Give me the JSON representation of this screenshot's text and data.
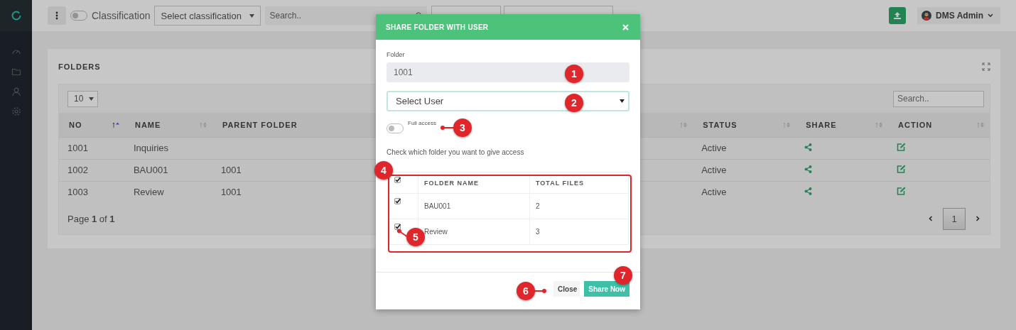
{
  "toolbar": {
    "classification_toggle": {
      "label": "Classification",
      "on": false
    },
    "classification_select": {
      "placeholder": "Select classification"
    },
    "search": {
      "placeholder": "Search.."
    },
    "user_menu": {
      "name": "DMS Admin"
    }
  },
  "panel": {
    "title": "FOLDERS",
    "page_length": "10",
    "search": {
      "placeholder": "Search.."
    },
    "table": {
      "columns": [
        {
          "label": "NO",
          "sorted": true
        },
        {
          "label": "NAME",
          "sorted": false
        },
        {
          "label": "PARENT FOLDER",
          "sorted": false
        },
        {
          "label": "STATUS",
          "sorted": false
        },
        {
          "label": "SHARE",
          "sorted": false
        },
        {
          "label": "ACTION",
          "sorted": false
        }
      ],
      "rows": [
        {
          "no": "1001",
          "name": "Inquiries",
          "status": "Active"
        },
        {
          "no": "1002",
          "name": "BAU001",
          "parent": "1001",
          "status": "Active"
        },
        {
          "no": "1003",
          "name": "Review",
          "parent": "1001",
          "status": "Active"
        }
      ]
    },
    "pagination": {
      "info": "Page **1** of **1**",
      "pages": [
        {
          "label": "1",
          "selected": true
        }
      ]
    }
  },
  "dialog": {
    "title": "SHARE FOLDER WITH USER",
    "folder_label": "Folder",
    "folder_value": "1001",
    "user_select": {
      "placeholder": "Select User"
    },
    "full_access": {
      "label": "Full access",
      "on": false
    },
    "instruction": "Check which folder you want to give access",
    "table": {
      "header_checked": true,
      "columns": [
        "FOLDER NAME",
        "TOTAL FILES"
      ],
      "rows": [
        {
          "name": "BAU001",
          "files": "2",
          "checked": true
        },
        {
          "name": "Review",
          "files": "3",
          "checked": true
        }
      ]
    },
    "buttons": [
      {
        "kind": "close",
        "label": "Close"
      },
      {
        "kind": "primary",
        "label": "Share Now"
      }
    ],
    "annotations": [
      {
        "label": "1"
      },
      {
        "label": "2"
      },
      {
        "label": "3"
      },
      {
        "label": "4"
      },
      {
        "label": "5"
      },
      {
        "label": "6"
      },
      {
        "label": "7"
      }
    ]
  }
}
